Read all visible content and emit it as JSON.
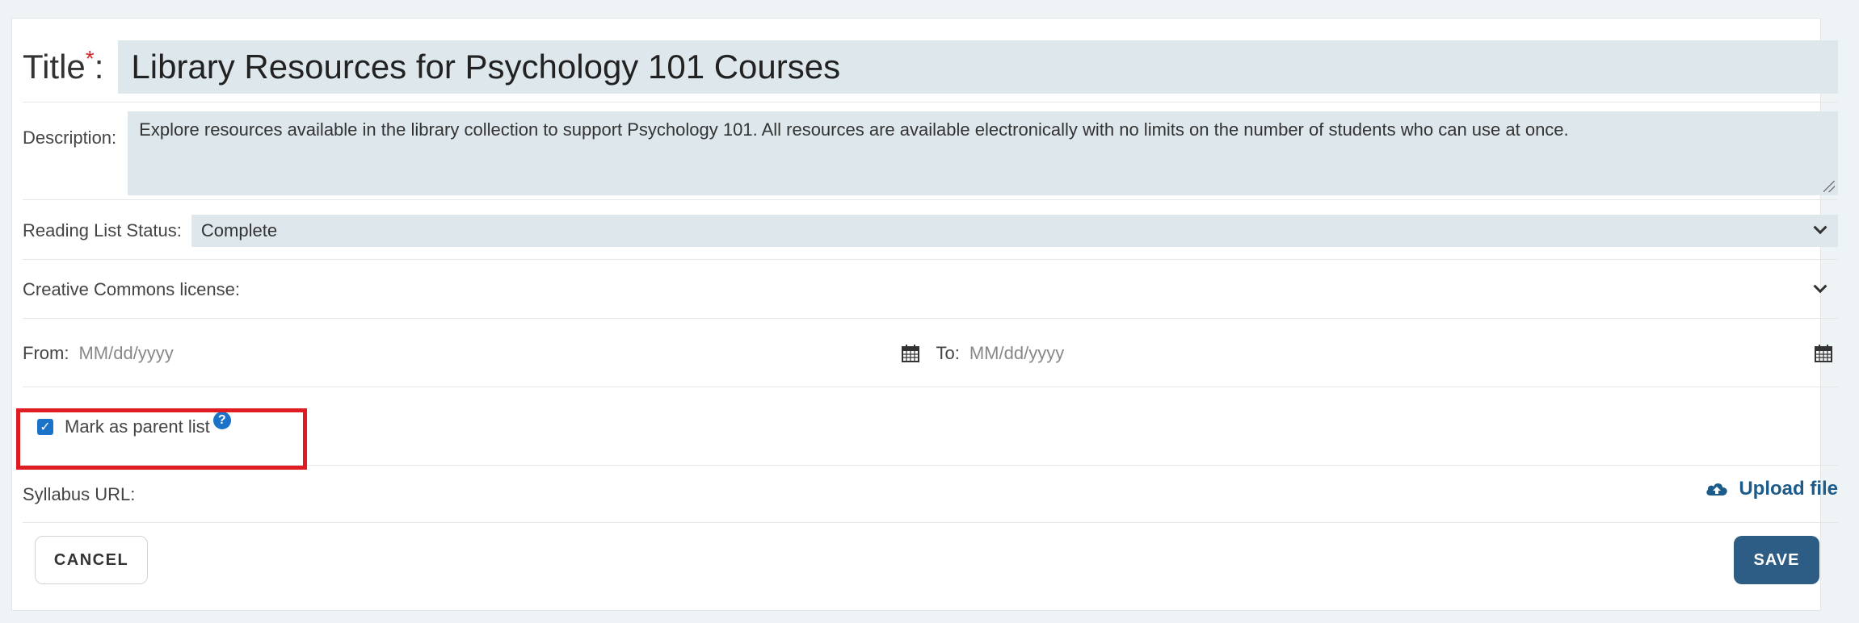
{
  "form": {
    "title_label": "Title",
    "title_required_mark": "*",
    "title_colon": ":",
    "title_value": "Library Resources for Psychology 101 Courses",
    "description_label": "Description:",
    "description_value": "Explore resources available in the library collection to support Psychology 101. All resources are available electronically with no limits on the number of students who can use at once.",
    "status_label": "Reading List Status:",
    "status_value": "Complete",
    "cc_label": "Creative Commons license:",
    "cc_value": "",
    "from_label": "From:",
    "from_placeholder": "MM/dd/yyyy",
    "to_label": "To:",
    "to_placeholder": "MM/dd/yyyy",
    "parent_label": "Mark as parent list",
    "parent_checked": true,
    "help_glyph": "?",
    "syllabus_label": "Syllabus URL:",
    "upload_label": "Upload file"
  },
  "buttons": {
    "cancel_label": "CANCEL",
    "save_label": "SAVE"
  },
  "icons": {
    "checkbox": "check-icon",
    "help": "question-circle-icon",
    "calendar": "calendar-icon",
    "upload": "cloud-upload-icon",
    "dropdown": "chevron-down-icon"
  },
  "colors": {
    "accent": "#1a73c9",
    "save_button": "#2d5d84",
    "upload_link": "#1d5b8a",
    "required": "#d9262d",
    "highlight_box": "#e11b22",
    "field_background": "#dee8ec"
  }
}
